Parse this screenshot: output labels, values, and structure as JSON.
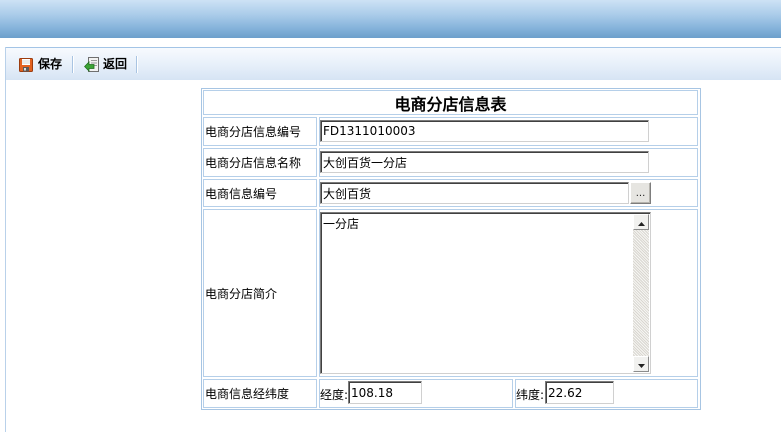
{
  "toolbar": {
    "save": {
      "label": "保存",
      "icon": "save-disk-icon"
    },
    "back": {
      "label": "返回",
      "icon": "back-arrow-icon"
    }
  },
  "form": {
    "title": "电商分店信息表",
    "branch_no": {
      "label": "电商分店信息编号",
      "value": "FD1311010003"
    },
    "branch_name": {
      "label": "电商分店信息名称",
      "value": "大创百货一分店"
    },
    "shop_no": {
      "label": "电商信息编号",
      "value": "大创百货",
      "picker_label": "..."
    },
    "intro": {
      "label": "电商分店简介",
      "value": "一分店"
    },
    "coords": {
      "label": "电商信息经纬度",
      "lng_label": "经度:",
      "lng_value": "108.18",
      "lat_label": "纬度:",
      "lat_value": "22.62"
    }
  },
  "colors": {
    "header_blue": "#7fafd9",
    "toolbar_bg": "#e3edf8",
    "table_border": "#a7c5e3",
    "save_icon": "#e2611f",
    "back_icon": "#3ca436"
  }
}
